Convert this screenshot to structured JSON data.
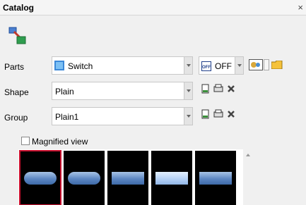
{
  "window": {
    "title": "Catalog",
    "close": "×"
  },
  "rows": {
    "parts": {
      "label": "Parts",
      "value": "Switch"
    },
    "shape": {
      "label": "Shape",
      "value": "Plain"
    },
    "group": {
      "label": "Group",
      "value": "Plain1"
    }
  },
  "state_combo": {
    "badge": "OFF",
    "value": "OFF"
  },
  "magnified": {
    "label": "Magnified view",
    "checked": false
  },
  "thumbnails": [
    {
      "selected": true,
      "style": "rounded"
    },
    {
      "selected": false,
      "style": "pill"
    },
    {
      "selected": false,
      "style": "plain"
    },
    {
      "selected": false,
      "style": "light"
    },
    {
      "selected": false,
      "style": "plain"
    }
  ],
  "icons": {
    "catalog": "catalog-tool-icon",
    "parts_item": "switch-part-icon",
    "export": "export-icon",
    "import": "import-icon",
    "delete": "delete-icon",
    "picture": "picture-icon",
    "folder": "folder-icon"
  }
}
